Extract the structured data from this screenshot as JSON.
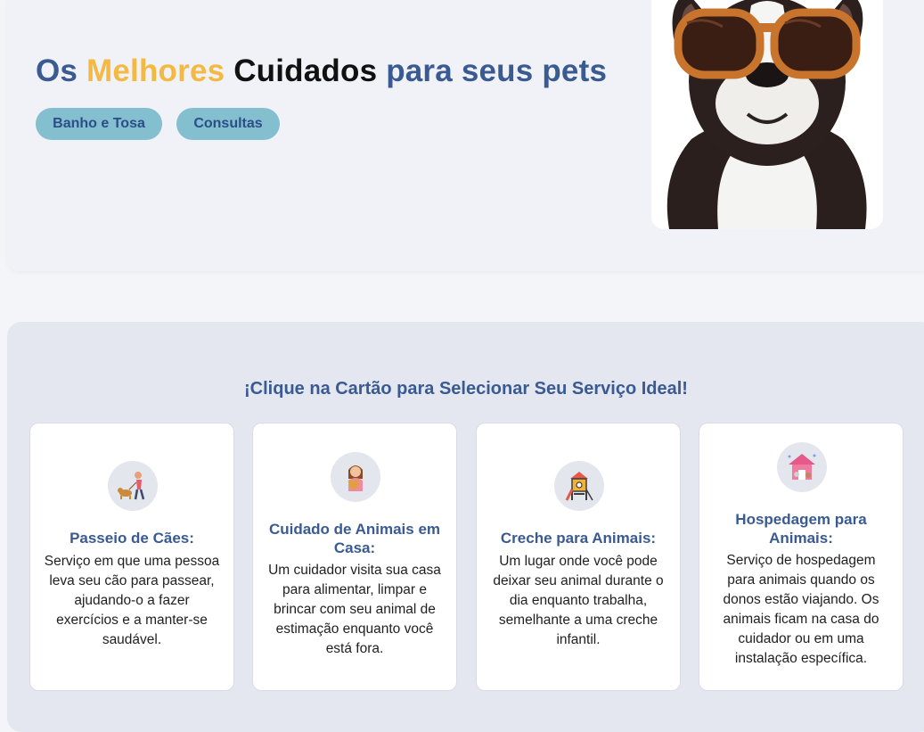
{
  "hero": {
    "title_part1": "Os ",
    "title_part2": "Melhores",
    "title_part3": " Cuidados ",
    "title_part4": "para seus pets",
    "buttons": [
      "Banho e Tosa",
      "Consultas"
    ]
  },
  "services": {
    "heading": "¡Clique na Cartão para Selecionar Seu Serviço Ideal!",
    "cards": [
      {
        "icon": "dog-walker-icon",
        "title": "Passeio de Cães:",
        "description": "Serviço em que uma pessoa leva seu cão para passear, ajudando-o a fazer exercícios e a manter-se saudável."
      },
      {
        "icon": "pet-sitter-icon",
        "title": "Cuidado de Animais em Casa:",
        "description": "Um cuidador visita sua casa para alimentar, limpar e brincar com seu animal de estimação enquanto você está fora."
      },
      {
        "icon": "playground-icon",
        "title": "Creche para Animais:",
        "description": "Um lugar onde você pode deixar seu animal durante o dia enquanto trabalha, semelhante a uma creche infantil."
      },
      {
        "icon": "pet-house-icon",
        "title": "Hospedagem para Animais:",
        "description": "Serviço de hospedagem para animais quando os donos estão viajando. Os animais ficam na casa do cuidador ou em uma instalação específica."
      }
    ]
  },
  "colors": {
    "brand_blue": "#3a5a92",
    "brand_yellow": "#f4b942",
    "pill_bg": "#83bfcf"
  }
}
